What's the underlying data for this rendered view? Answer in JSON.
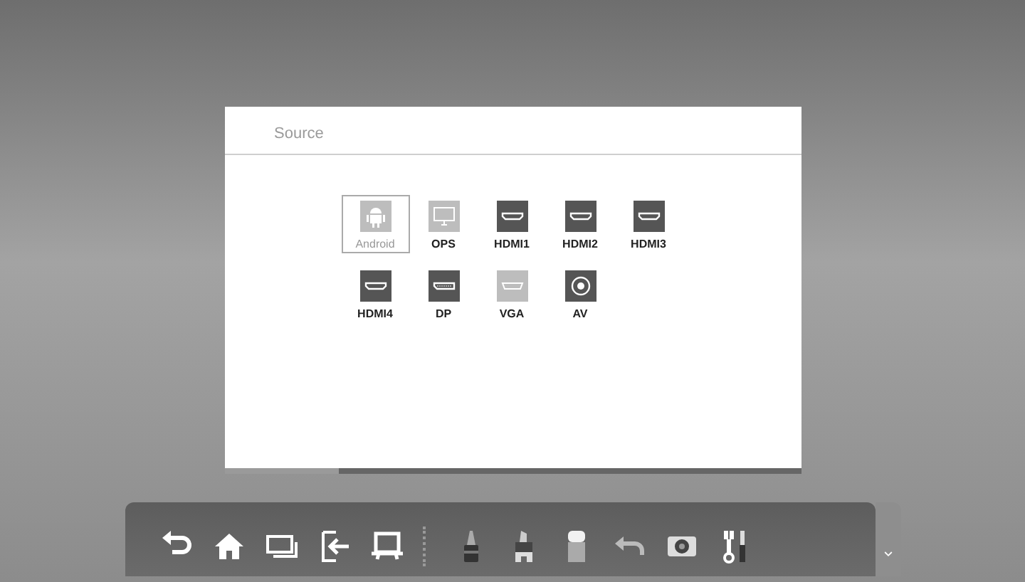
{
  "dialog": {
    "title": "Source"
  },
  "sources": [
    {
      "label": "Android",
      "kind": "android",
      "selected": true,
      "dimmed": true
    },
    {
      "label": "OPS",
      "kind": "monitor",
      "selected": false,
      "dimmed": true
    },
    {
      "label": "HDMI1",
      "kind": "hdmi",
      "selected": false,
      "dimmed": false
    },
    {
      "label": "HDMI2",
      "kind": "hdmi",
      "selected": false,
      "dimmed": false
    },
    {
      "label": "HDMI3",
      "kind": "hdmi",
      "selected": false,
      "dimmed": false
    },
    {
      "label": "HDMI4",
      "kind": "hdmi",
      "selected": false,
      "dimmed": false
    },
    {
      "label": "DP",
      "kind": "dp",
      "selected": false,
      "dimmed": false
    },
    {
      "label": "VGA",
      "kind": "vga",
      "selected": false,
      "dimmed": true
    },
    {
      "label": "AV",
      "kind": "av",
      "selected": false,
      "dimmed": false
    }
  ]
}
